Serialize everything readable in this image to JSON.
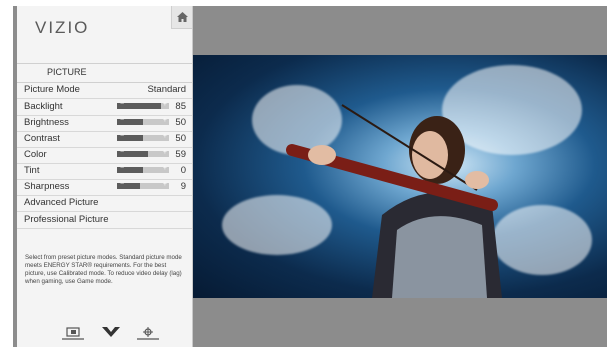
{
  "app": {
    "brand": "VIZIO"
  },
  "menu": {
    "title": "PICTURE",
    "picture_mode": {
      "label": "Picture Mode",
      "value": "Standard"
    },
    "settings": [
      {
        "label": "Backlight",
        "value": "85",
        "level": 0.85
      },
      {
        "label": "Brightness",
        "value": "50",
        "level": 0.5
      },
      {
        "label": "Contrast",
        "value": "50",
        "level": 0.5
      },
      {
        "label": "Color",
        "value": "59",
        "level": 0.59
      },
      {
        "label": "Tint",
        "value": "0",
        "level": 0.5
      },
      {
        "label": "Sharpness",
        "value": "9",
        "level": 0.45
      }
    ],
    "advanced_label": "Advanced Picture",
    "professional_label": "Professional Picture",
    "description": "Select from preset picture modes. Standard picture mode meets ENERGY STAR® requirements. For the best picture, use Calibrated mode. To reduce video delay (lag) when gaming, use Game mode."
  },
  "footer_icons": [
    "input-icon",
    "vizio-v-icon",
    "settings-gear-icon"
  ],
  "colors": {
    "screen_bg": "#8c8c8c",
    "menu_bg": "#f4f4f4",
    "slider_fill": "#5c5c5c"
  }
}
